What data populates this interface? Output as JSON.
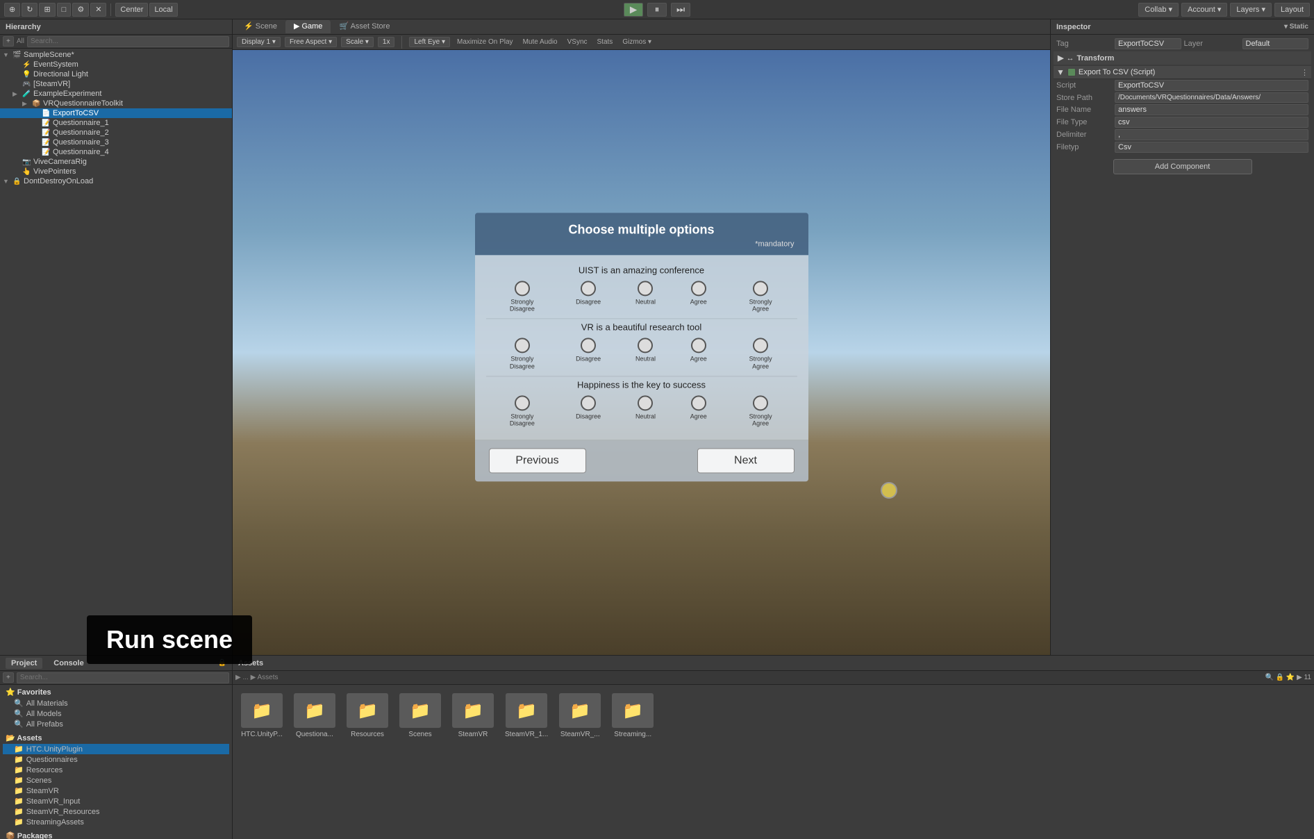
{
  "toolbar": {
    "pivot_label": "Center",
    "transform_label": "Local",
    "play_icon": "▶",
    "pause_icon": "⏸",
    "step_icon": "⏭",
    "collab_label": "Collab ▾",
    "account_label": "Account ▾",
    "layers_label": "Layers ▾",
    "layout_label": "Layout"
  },
  "hierarchy": {
    "title": "Hierarchy",
    "all_label": "All",
    "items": [
      {
        "label": "SampleScene*",
        "depth": 0,
        "has_arrow": true,
        "icon": "🎬"
      },
      {
        "label": "EventSystem",
        "depth": 1,
        "has_arrow": false,
        "icon": "⚡"
      },
      {
        "label": "Directional Light",
        "depth": 1,
        "has_arrow": false,
        "icon": "💡"
      },
      {
        "label": "[SteamVR]",
        "depth": 1,
        "has_arrow": false,
        "icon": "🎮"
      },
      {
        "label": "ExampleExperiment",
        "depth": 1,
        "has_arrow": true,
        "icon": "🧪"
      },
      {
        "label": "VRQuestionnaireToolkit",
        "depth": 2,
        "has_arrow": true,
        "icon": "📦"
      },
      {
        "label": "ExportToCSV",
        "depth": 3,
        "has_arrow": false,
        "icon": "📄",
        "selected": true
      },
      {
        "label": "Questionnaire_1",
        "depth": 3,
        "has_arrow": false,
        "icon": "📝"
      },
      {
        "label": "Questionnaire_2",
        "depth": 3,
        "has_arrow": false,
        "icon": "📝"
      },
      {
        "label": "Questionnaire_3",
        "depth": 3,
        "has_arrow": false,
        "icon": "📝"
      },
      {
        "label": "Questionnaire_4",
        "depth": 3,
        "has_arrow": false,
        "icon": "📝"
      },
      {
        "label": "ViveCameraRig",
        "depth": 1,
        "has_arrow": false,
        "icon": "📷"
      },
      {
        "label": "VivePointers",
        "depth": 1,
        "has_arrow": false,
        "icon": "👆"
      },
      {
        "label": "DontDestroyOnLoad",
        "depth": 0,
        "has_arrow": true,
        "icon": "🔒"
      }
    ]
  },
  "view_tabs": {
    "tabs": [
      "Scene",
      "Game",
      "Asset Store"
    ],
    "active": "Game"
  },
  "view_toolbar_game": {
    "items": [
      "Display 1",
      "Free Aspect",
      "Scale",
      "1x",
      "Left Eye",
      "Maximize On Play",
      "Mute Audio",
      "VSync",
      "Stats",
      "Gizmos"
    ]
  },
  "questionnaire": {
    "title": "Choose multiple options",
    "mandatory_label": "*mandatory",
    "questions": [
      {
        "text": "UIST is an amazing conference",
        "options": [
          "Strongly\nDisagree",
          "Disagree",
          "Neutral",
          "Agree",
          "Strongly\nAgree"
        ],
        "selected": -1
      },
      {
        "text": "VR is a beautiful research tool",
        "options": [
          "Strongly\nDisagree",
          "Disagree",
          "Neutral",
          "Agree",
          "Strongly\nAgree"
        ],
        "selected": -1
      },
      {
        "text": "Happiness is the key to success",
        "options": [
          "Strongly\nDisagree",
          "Disagree",
          "Neutral",
          "Agree",
          "Strongly\nAgree"
        ],
        "selected": -1
      }
    ],
    "prev_label": "Previous",
    "next_label": "Next"
  },
  "inspector": {
    "title": "Inspector",
    "tag_label": "Tag",
    "tag_value": "ExportToCSV",
    "layer_label": "Layer",
    "layer_value": "Default",
    "transform_section": "Transform",
    "component_name": "Export To CSV (Script)",
    "script_label": "Script",
    "script_value": "ExportToCSV",
    "store_path_label": "Store Path",
    "store_path_value": "/Documents/VRQuestionnaires/Data/Answers/",
    "file_name_label": "File Name",
    "file_name_value": "answers",
    "file_type_label": "File Type",
    "file_type_value": "csv",
    "delimiter_label": "Delimiter",
    "delimiter_value": ",",
    "filetyp_label": "Filetyp",
    "filetyp_value": "Csv",
    "add_component_label": "Add Component"
  },
  "bottom": {
    "project_label": "Project",
    "console_label": "Console",
    "assets_label": "Assets",
    "favorites": {
      "label": "Favorites",
      "items": [
        "All Materials",
        "All Models",
        "All Prefabs"
      ]
    },
    "assets_tree": {
      "label": "Assets",
      "items": [
        "HTC.UnityPlugin",
        "Questionnaires",
        "Resources",
        "Scenes",
        "SteamVR",
        "SteamVR_Input",
        "SteamVR_Resources",
        "StreamingAssets"
      ]
    },
    "packages_label": "Packages",
    "asset_folders": [
      {
        "label": "HTC.UnityP...",
        "icon": "📁"
      },
      {
        "label": "Questiona...",
        "icon": "📁"
      },
      {
        "label": "Resources",
        "icon": "📁"
      },
      {
        "label": "Scenes",
        "icon": "📁"
      },
      {
        "label": "SteamVR",
        "icon": "📁"
      },
      {
        "label": "SteamVR_1...",
        "icon": "📁"
      },
      {
        "label": "SteamVR_...",
        "icon": "📁"
      },
      {
        "label": "Streaming...",
        "icon": "📁"
      }
    ]
  },
  "run_scene_label": "Run scene"
}
